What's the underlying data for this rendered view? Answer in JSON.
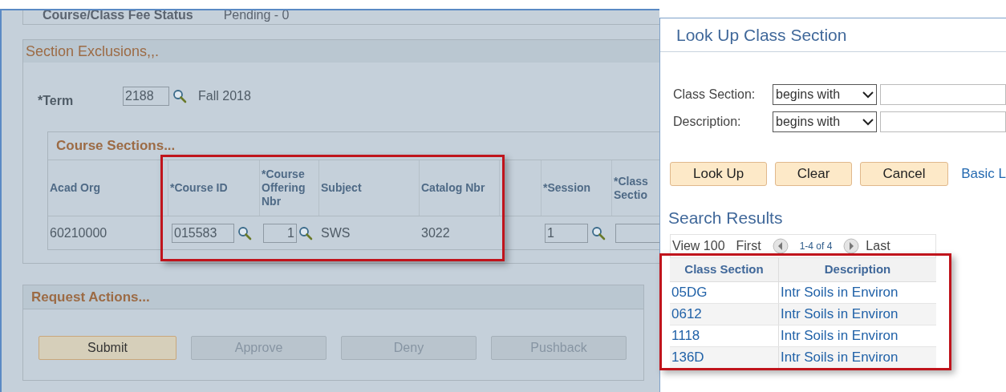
{
  "fee_status": {
    "label": "Course/Class Fee Status",
    "value": "Pending - 0"
  },
  "section_exclusions": {
    "title": "Section Exclusions,,.",
    "term": {
      "label": "*Term",
      "value": "2188",
      "description": "Fall 2018"
    }
  },
  "course_sections": {
    "title": "Course Sections...",
    "columns": [
      "Acad Org",
      "*Course ID",
      "*Course Offering Nbr",
      "Subject",
      "Catalog Nbr",
      "",
      "*Session",
      "*Class Sectio"
    ],
    "rows": [
      {
        "acad_org": "60210000",
        "course_id": "015583",
        "offering_nbr": "1",
        "subject": "SWS",
        "catalog_nbr": "3022",
        "session": "1"
      }
    ]
  },
  "request_actions": {
    "title": "Request Actions...",
    "buttons": [
      {
        "label": "Submit",
        "disabled": false
      },
      {
        "label": "Approve",
        "disabled": true
      },
      {
        "label": "Deny",
        "disabled": true
      },
      {
        "label": "Pushback",
        "disabled": true
      }
    ]
  },
  "lookup": {
    "title": "Look Up Class Section",
    "criteria": [
      {
        "label": "Class Section:",
        "operator": "begins with"
      },
      {
        "label": "Description:",
        "operator": "begins with"
      }
    ],
    "buttons": [
      "Look Up",
      "Clear",
      "Cancel"
    ],
    "link": "Basic L",
    "results_title": "Search Results",
    "nav": {
      "view": "View 100",
      "first": "First",
      "range": "1-4 of 4",
      "last": "Last"
    },
    "columns": [
      "Class Section",
      "Description"
    ],
    "rows": [
      {
        "section": "05DG",
        "description": "Intr Soils in Environ"
      },
      {
        "section": "0612",
        "description": "Intr Soils in Environ"
      },
      {
        "section": "1118",
        "description": "Intr Soils in Environ"
      },
      {
        "section": "136D",
        "description": "Intr Soils in Environ"
      }
    ]
  }
}
